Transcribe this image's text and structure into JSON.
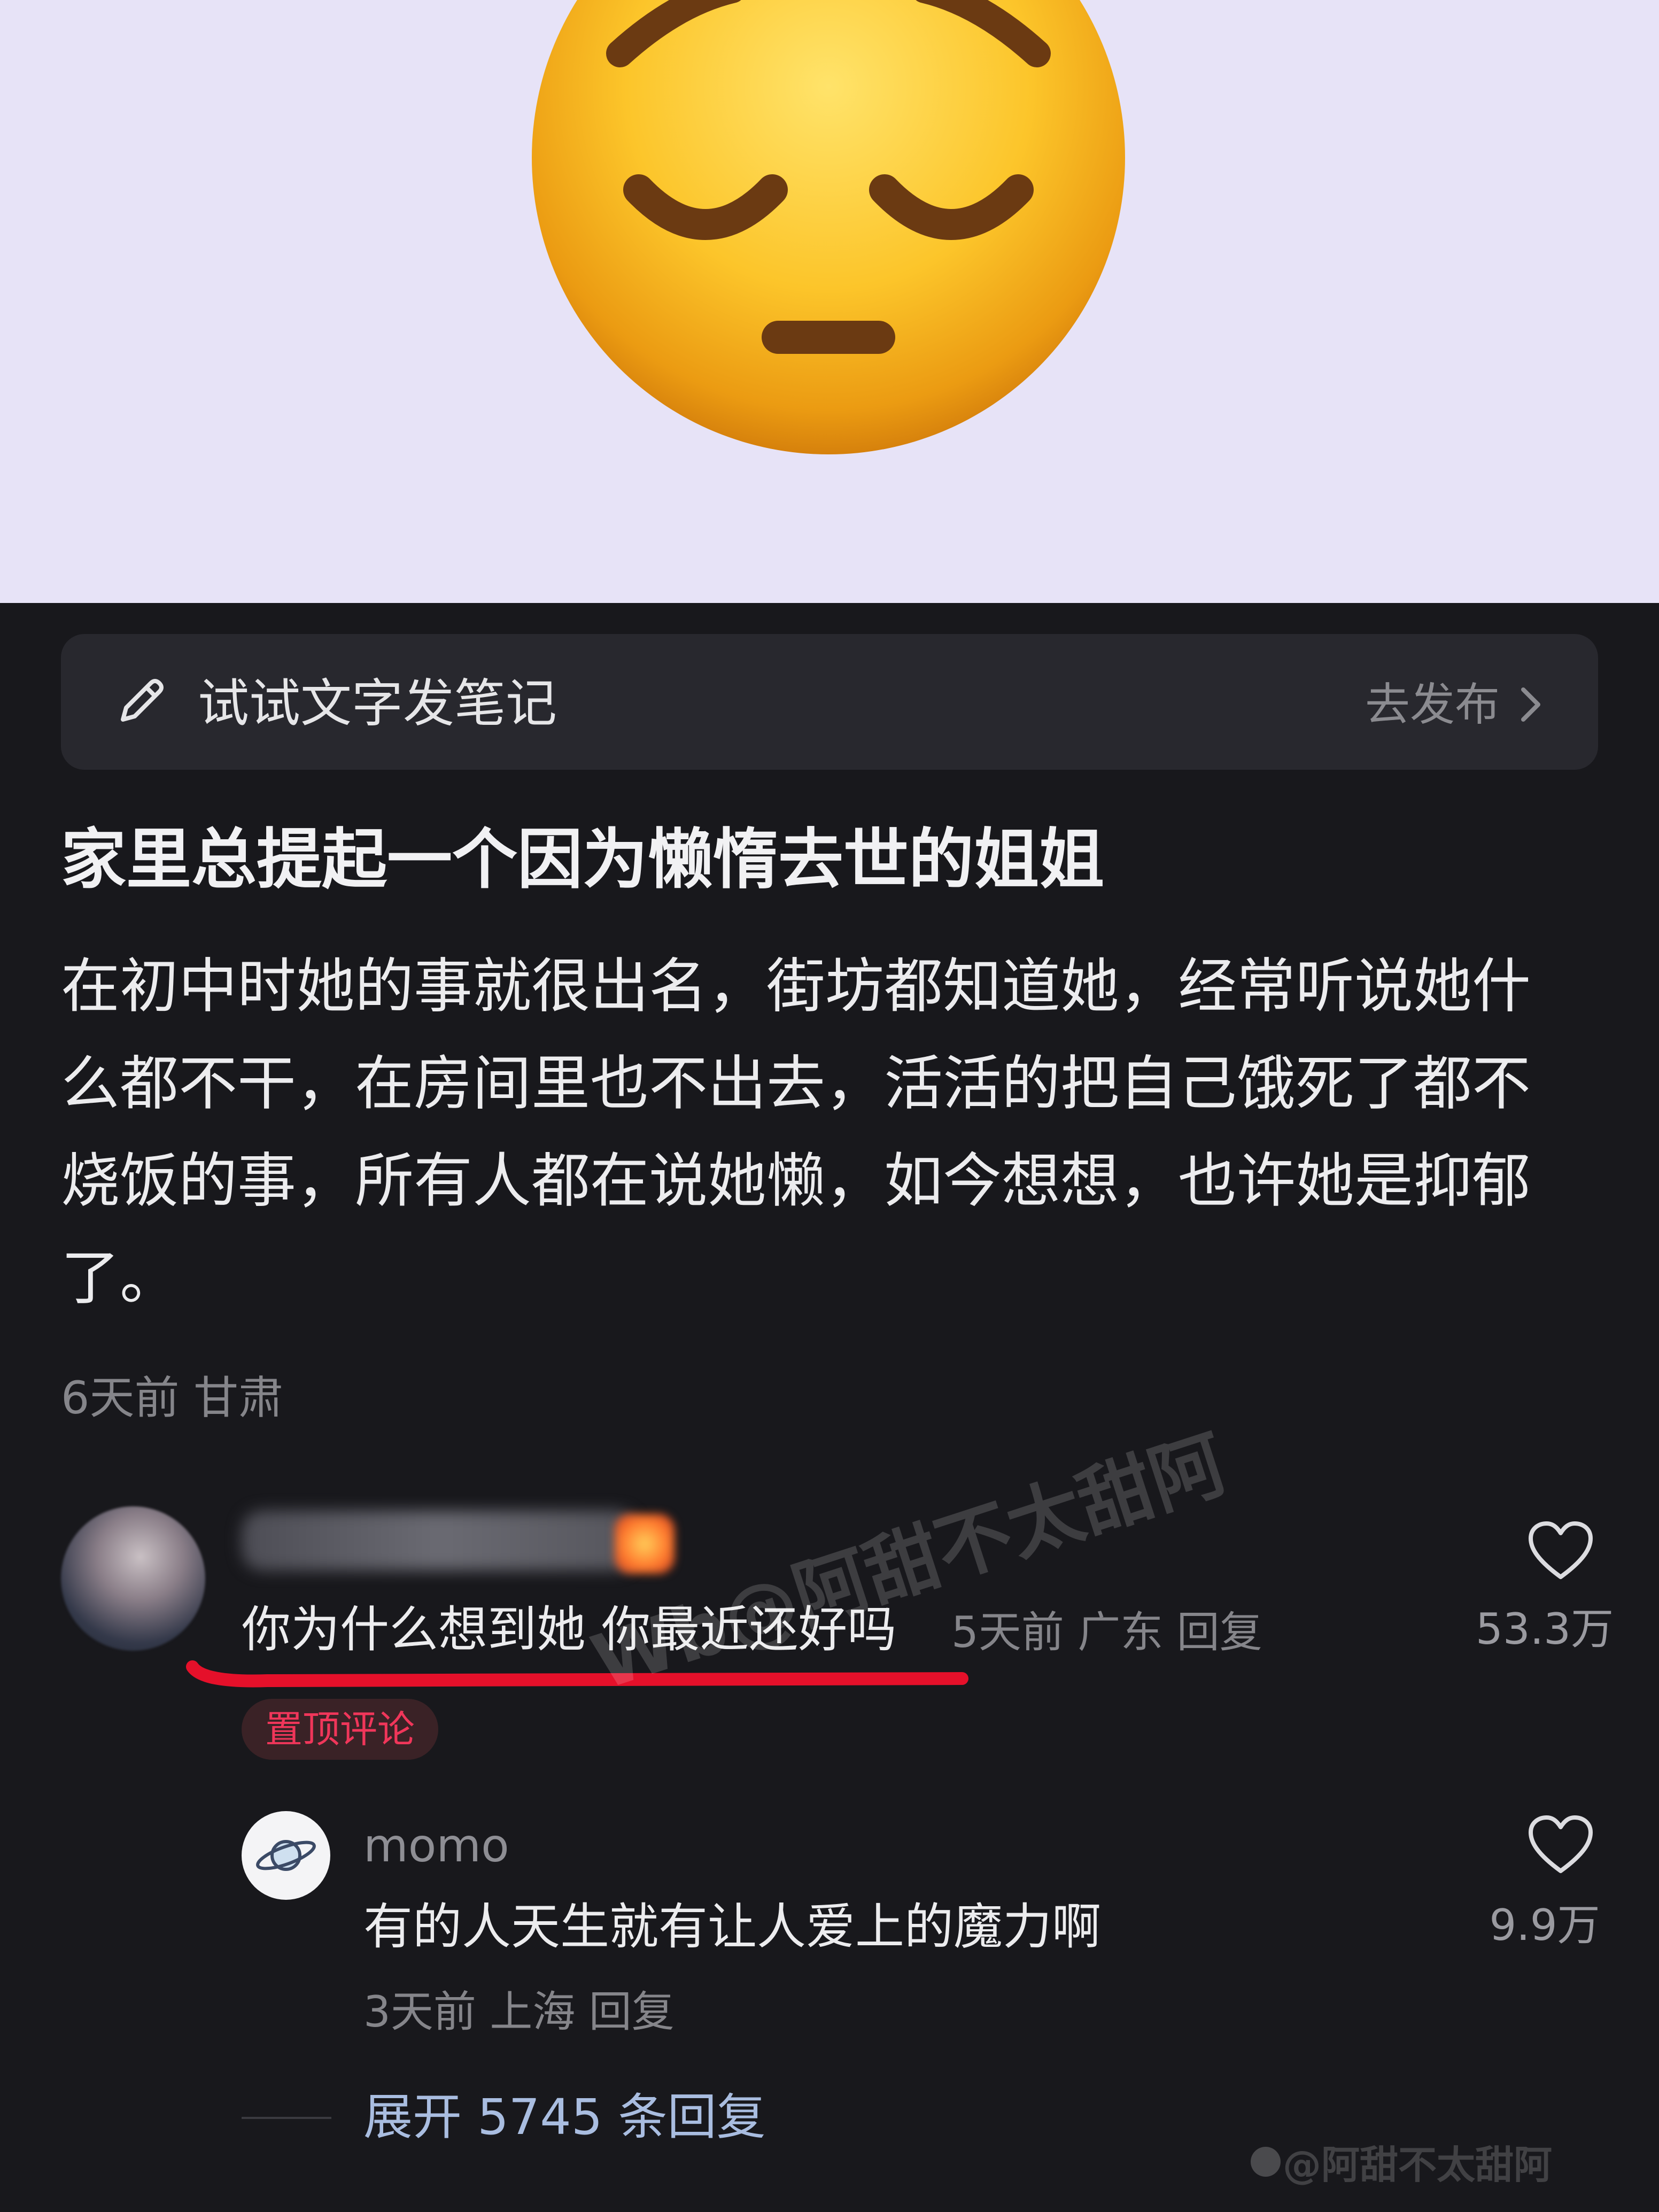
{
  "hero": {
    "background": "#e7e3f7",
    "emoji": "pensive-face-emoji"
  },
  "compose": {
    "icon": "pencil-icon",
    "placeholder_text": "试试文字发笔记",
    "action_label": "去发布",
    "action_icon": "chevron-right-icon"
  },
  "post": {
    "title": "家里总提起一个因为懒惰去世的姐姐",
    "body_lines": [
      "在初中时她的事就很出名，街坊都知道她，经常听说她什",
      "么都不干，在房间里也不出去，活活的把自己饿死了都不",
      "烧饭的事，所有人都在说她懒，如今想想，也许她是抑郁",
      "了。"
    ],
    "meta": "6天前 甘肃"
  },
  "comments": [
    {
      "text": "你为什么想到她 你最近还好吗",
      "meta": "5天前 广东 回复",
      "badge": "置顶评论",
      "likes": "53.3万",
      "underline_color": "#e5102a",
      "replies": [
        {
          "user": "momo",
          "text": "有的人天生就有让人爱上的魔力啊",
          "meta": "3天前 上海 回复",
          "likes": "9.9万"
        }
      ],
      "expand_label": "展开 5745 条回复"
    }
  ],
  "watermarks": {
    "diagonal": "Wb@阿甜不太甜阿",
    "corner": "@阿甜不太甜阿"
  },
  "colors": {
    "background": "#18181c",
    "pin_badge_text": "#f0365a",
    "expand_link": "#a9bde0"
  }
}
